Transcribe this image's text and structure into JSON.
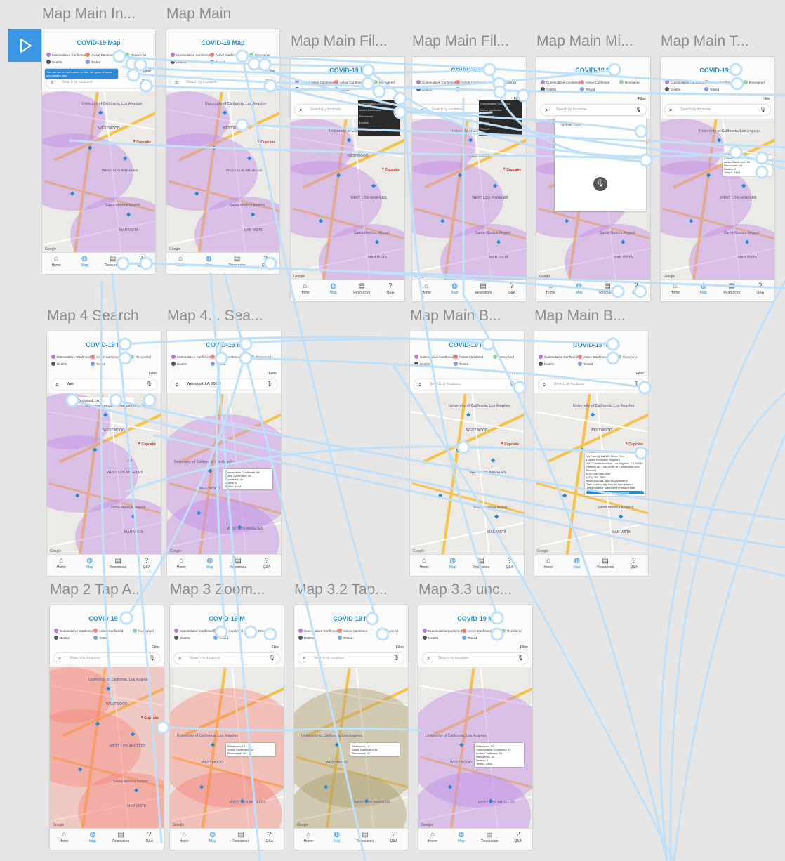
{
  "colors": {
    "canvas": "#e6e6e6",
    "accent": "#1e90d8",
    "wire": "#bfe0fa",
    "cumulative": "#b77ad9",
    "active": "#f08070",
    "recovered": "#8fd49a",
    "deaths": "#555555",
    "tested": "#7b9fe0",
    "violet_overlay": "rgba(196,140,230,0.45)",
    "red_overlay": "rgba(246,120,110,0.38)",
    "olive_overlay": "rgba(175,160,110,0.45)"
  },
  "play_button": {
    "icon": "play-icon"
  },
  "app": {
    "title": "COVID-19 Map",
    "title_cut": "COVID-19 M",
    "filter": "Filter",
    "search_placeholder": "Search by locations",
    "legend": [
      "Cummulative Confirmed",
      "Active Confirmed",
      "Recovered",
      "Deaths",
      "Tested"
    ],
    "nav": [
      "Home",
      "Map",
      "Resources",
      "Q&A"
    ],
    "nav_icons": [
      "home-icon",
      "globe-icon",
      "newspaper-icon",
      "question-icon"
    ],
    "map_places": [
      "University of California, Los Angeles",
      "WESTWOOD",
      "WEST LOS ANGELES",
      "Santa Monica Airport",
      "MAR VISTA",
      "Cupcake"
    ],
    "google": "Google"
  },
  "boards": [
    {
      "label": "Map Main In...",
      "variant": "violet",
      "tooltip": "You can tap on the buttons to filter the types of cases you want to view."
    },
    {
      "label": "Map Main",
      "variant": "violet"
    },
    {
      "label": "Map Main Fil...",
      "variant": "violet",
      "dropdown": true
    },
    {
      "label": "Map Main Fil...",
      "variant": "violet",
      "dropdown": true
    },
    {
      "label": "Map Main Mi...",
      "variant": "violet",
      "voice": "Speak Now"
    },
    {
      "label": "Map Main T...",
      "variant": "violet",
      "popup": "Cummulative Confirmed: 64\nActive Confirmed: 50\nRecovered: 44\nDeaths: 0\nTested: 4444"
    },
    {
      "label": "Map 4 Search",
      "variant": "violet",
      "search_value": "Wes",
      "suggestion": "Westwood, LA, ..."
    },
    {
      "label": "Map 4... Sea...",
      "variant": "zoomviolet",
      "search_value": "Westwood, LA, 90024",
      "popup": "Cummulative Confirmed: 64\nActive Confirmed: 50\nRecovered: 44\nDeaths: 0\nTested: 4444"
    },
    {
      "label": "Map Main B...",
      "variant": "plain"
    },
    {
      "label": "Map Main B...",
      "variant": "plain",
      "popup": "VA Parking Lot 15 - Drive Thru\n(Jackie Robinson Stadium)\n100 Constitution Ave, Los Angeles, CA 90049\nParking Lot 15 (Corner of Constitution and Bonsall)\nMon-Sun 9am-4pm\n(310) 268-3900\nhttps://corona-virus.la.gov/testing\nThis location requires an appointment\nTests must be scheduled ahead of time",
      "popup_button": "Schedule Appointment"
    },
    {
      "label": "Map 2 Tap A...",
      "variant": "red"
    },
    {
      "label": "Map 3 Zoom...",
      "variant": "zoomred",
      "popup": "Westwood, LA\nActive Confirmed: 64\nRecovered: 44"
    },
    {
      "label": "Map 3.2 Tap...",
      "variant": "zoomolive",
      "popup": "Westwood, LA\nActive Confirmed: 64\nRecovered: 44"
    },
    {
      "label": "Map 3.3 unc...",
      "variant": "zoomviolet",
      "popup": "Westwood, LA\nCummulative Confirmed: 64\nActive Confirmed: 50\nRecovered: 44\nDeaths: 0\nTested: 4444"
    }
  ]
}
